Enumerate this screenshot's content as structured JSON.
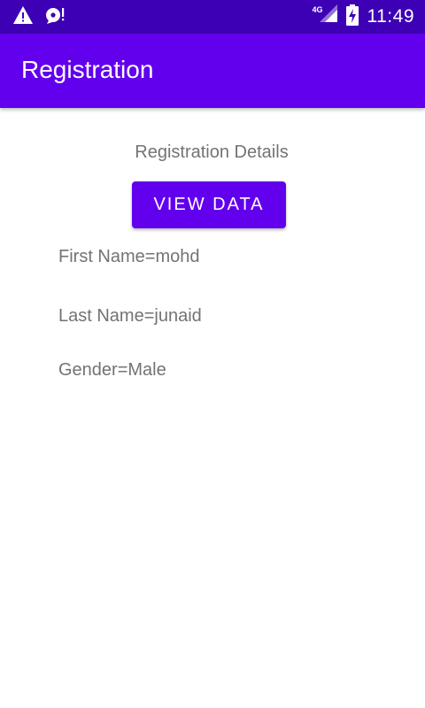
{
  "status_bar": {
    "time": "11:49",
    "network": "4G",
    "icons": [
      "warning-icon",
      "sd-card-alert-icon",
      "signal-icon",
      "battery-charging-icon"
    ],
    "background": "#3d00b5"
  },
  "app_bar": {
    "title": "Registration",
    "background": "#6200ee"
  },
  "content": {
    "heading": "Registration Details",
    "button_label": "VIEW DATA",
    "fields": [
      "First Name=mohd",
      "Last Name=junaid",
      "Gender=Male"
    ],
    "text_color": "#737373"
  }
}
